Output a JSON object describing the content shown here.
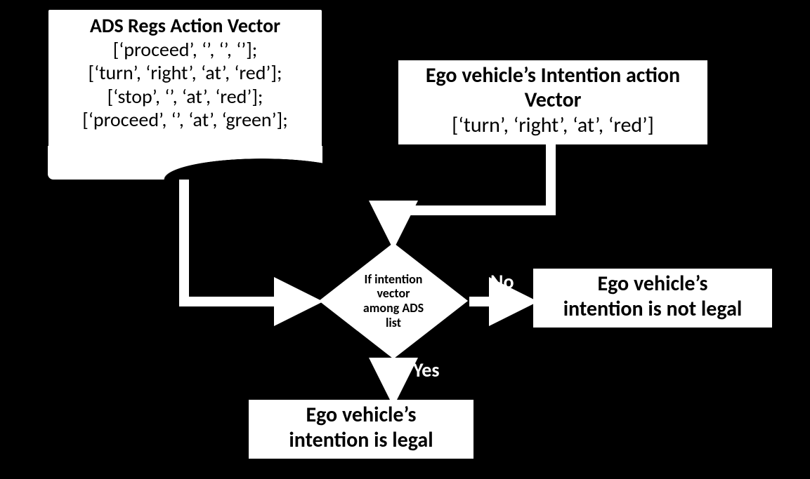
{
  "ads": {
    "title": "ADS Regs Action Vector",
    "rows": [
      "[‘proceed’, ‘’, ‘’, ‘’];",
      "[‘turn’, ‘right’, ‘at’, ‘red’];",
      "[‘stop’, ‘’, ‘at’, ‘red’];",
      "[‘proceed’, ‘’, ‘at’, ‘green’];"
    ],
    "ellipsis": "…"
  },
  "ego": {
    "title_line1": "Ego vehicle’s Intention action",
    "title_line2": "Vector",
    "vector": "[‘turn’, ‘right’, ‘at’, ‘red’]"
  },
  "decision": {
    "l1": "If intention",
    "l2": "vector",
    "l3": "among ADS",
    "l4": "list"
  },
  "edges": {
    "no": "No",
    "yes": "Yes"
  },
  "results": {
    "not_legal_l1": "Ego vehicle’s",
    "not_legal_l2": "intention is not legal",
    "legal_l1": "Ego vehicle’s",
    "legal_l2": "intention is legal"
  },
  "chart_data": {
    "type": "flowchart",
    "nodes": [
      {
        "id": "ads",
        "kind": "document",
        "title": "ADS Regs Action Vector",
        "content": [
          "['proceed','','','']",
          "['turn','right','at','red']",
          "['stop','','at','red']",
          "['proceed','','at','green']",
          "..."
        ]
      },
      {
        "id": "ego",
        "kind": "process",
        "title": "Ego vehicle's Intention action Vector",
        "content": [
          "['turn','right','at','red']"
        ]
      },
      {
        "id": "decision",
        "kind": "decision",
        "title": "If intention vector among ADS list"
      },
      {
        "id": "not_legal",
        "kind": "terminal",
        "title": "Ego vehicle's intention is not legal"
      },
      {
        "id": "legal",
        "kind": "terminal",
        "title": "Ego vehicle's intention is legal"
      }
    ],
    "edges": [
      {
        "from": "ads",
        "to": "decision",
        "label": ""
      },
      {
        "from": "ego",
        "to": "decision",
        "label": ""
      },
      {
        "from": "decision",
        "to": "not_legal",
        "label": "No"
      },
      {
        "from": "decision",
        "to": "legal",
        "label": "Yes"
      }
    ]
  }
}
